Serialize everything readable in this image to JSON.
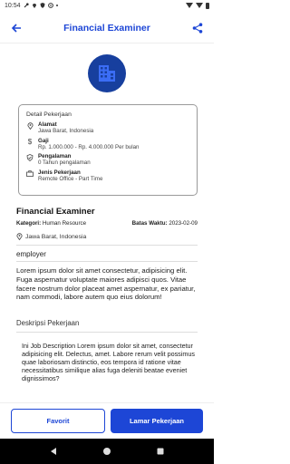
{
  "status": {
    "time": "10:54"
  },
  "appbar": {
    "title": "Financial Examiner",
    "back_icon": "arrow-left-icon",
    "share_icon": "share-icon"
  },
  "card": {
    "heading": "Detail Pekerjaan",
    "items": [
      {
        "label": "Alamat",
        "value": "Jawa Barat, Indonesia",
        "icon": "location-icon"
      },
      {
        "label": "Gaji",
        "value": "Rp. 1.000.000 - Rp. 4.000.000 Per bulan",
        "icon": "dollar-icon"
      },
      {
        "label": "Pengalaman",
        "value": "0 Tahun pengalaman",
        "icon": "badge-icon"
      },
      {
        "label": "Jenis Pekerjaan",
        "value": "Remote Office - Part Time",
        "icon": "briefcase-icon"
      }
    ]
  },
  "job": {
    "title": "Financial Examiner",
    "category_label": "Kategori:",
    "category_value": "Human Resource",
    "deadline_label": "Batas Waktu:",
    "deadline_value": "2023-02-09",
    "location": "Jawa Barat, Indonesia",
    "company": "employer",
    "summary": "Lorem ipsum dolor sit amet consectetur, adipisicing elit. Fuga aspernatur voluptate maiores adipisci quos. Vitae facere nostrum dolor placeat amet aspernatur, ex pariatur, nam commodi, labore autem quo eius dolorum!",
    "desc_heading": "Deskripsi Pekerjaan",
    "description": "Ini Job Description Lorem ipsum dolor sit amet, consectetur adipisicing elit. Delectus, amet. Labore rerum velit possimus quae laboriosam distinctio, eos tempora id ratione vitae necessitatibus similique alias fuga deleniti beatae eveniet dignissimos?"
  },
  "actions": {
    "favorite_label": "Favorit",
    "apply_label": "Lamar Pekerjaan"
  },
  "colors": {
    "primary": "#1d46d6",
    "logo_bg": "#173f9e"
  }
}
